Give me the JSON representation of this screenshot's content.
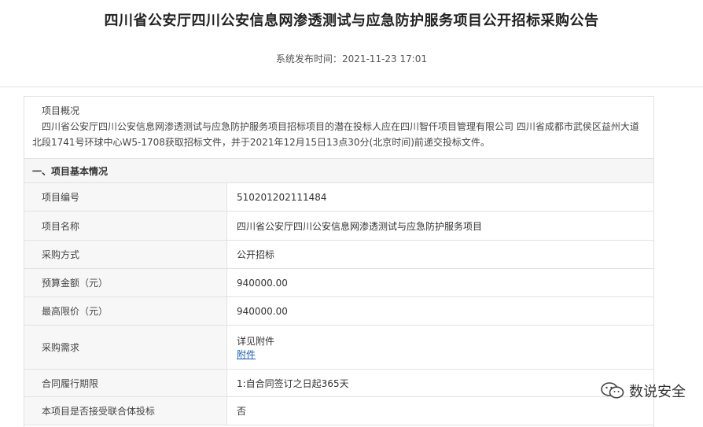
{
  "header": {
    "title": "四川省公安厅四川公安信息网渗透测试与应急防护服务项目公开招标采购公告",
    "publish_label": "系统发布时间：",
    "publish_time": "2021-11-23 17:01"
  },
  "overview": {
    "title": "项目概况",
    "body": "四川省公安厅四川公安信息网渗透测试与应急防护服务项目招标项目的潜在投标人应在四川智仟项目管理有限公司 四川省成都市武侯区益州大道北段1741号环球中心W5-1708获取招标文件，并于2021年12月15日13点30分(北京时间)前递交投标文件。"
  },
  "section": {
    "title": "一、项目基本情况"
  },
  "rows": [
    {
      "label": "项目编号",
      "value": "510201202111484"
    },
    {
      "label": "项目名称",
      "value": "四川省公安厅四川公安信息网渗透测试与应急防护服务项目"
    },
    {
      "label": "采购方式",
      "value": "公开招标"
    },
    {
      "label": "预算金额（元）",
      "value": "940000.00"
    },
    {
      "label": "最高限价（元）",
      "value": "940000.00"
    },
    {
      "label": "采购需求",
      "value": "详见附件",
      "link": "附件"
    },
    {
      "label": "合同履行期限",
      "value": "1:自合同签订之日起365天"
    },
    {
      "label": "本项目是否接受联合体投标",
      "value": "否"
    }
  ],
  "watermark": {
    "text": "数说安全",
    "icon": "wechat-icon"
  }
}
